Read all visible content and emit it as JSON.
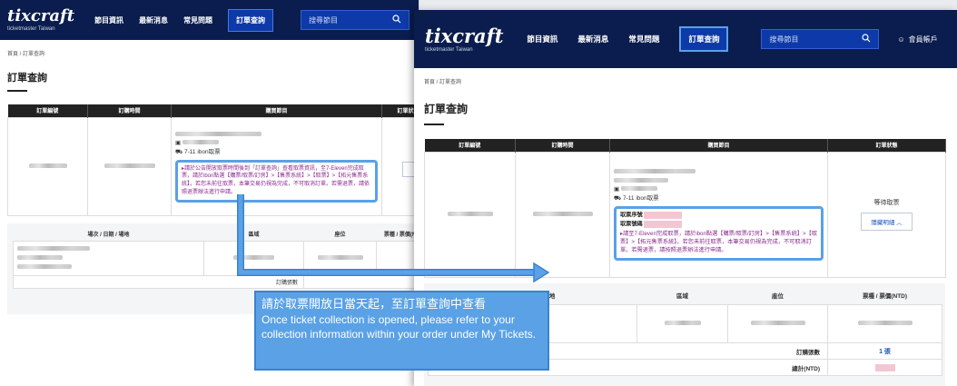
{
  "brand": {
    "name": "tixcraft",
    "sub": "ticketmaster Taiwan"
  },
  "nav": {
    "items": [
      "節目資訊",
      "最新消息",
      "常見問題",
      "訂單查詢"
    ],
    "search_placeholder": "搜尋節目",
    "member": "會員帳戶"
  },
  "breadcrumb": {
    "home": "首頁",
    "current": "訂單查詢"
  },
  "page": {
    "title": "訂單查詢"
  },
  "order_table": {
    "headers": [
      "訂單編號",
      "訂購時間",
      "購買節目",
      "訂單狀態"
    ],
    "delivery": "7-11 ibon取票",
    "ticket_no_label": "取票序號",
    "ticket_code_label": "取票號碼",
    "notice_old": "▸請於公告開放取票時間後到「訂單查詢」查看取票資訊，至7-Eleven完成取票，請於ibon點選【購票/取票/訂房】>【售票系統】>【取票】>【拓元售票系統】。若您未前往取票，本筆交易仍視為完成，不可取消訂單。若需退票，請依照退票辦法進行申請。",
    "notice_new": "▸請至7-Eleven完成取票，請於ibon點選【購票/取票/訂房】>【售票系統】>【取票】>【拓元售票系統】。若您未前往取票，本筆交易仍視為完成，不可取消訂單。若需退票，請按照退票辦法進行申請。",
    "status": "等待取票",
    "toggle": "隱藏明細 ︿"
  },
  "detail_table": {
    "headers": [
      "場次 / 日期 / 場地",
      "區域",
      "座位",
      "票種 / 票價(NTD)"
    ],
    "ticket_count_label": "訂購張數",
    "ticket_count": "1 張",
    "total_label": "總計(NTD)"
  },
  "callout": {
    "zh": "請於取票開放日當天起，至訂單查詢中查看",
    "en": "Once ticket collection is opened, please refer to your collection information within your order under My Tickets."
  },
  "colors": {
    "header": "#0a1d4e",
    "nav_active": "#0d3aa8",
    "callout": "#5aa1e6",
    "purple": "#8a2b8f"
  }
}
